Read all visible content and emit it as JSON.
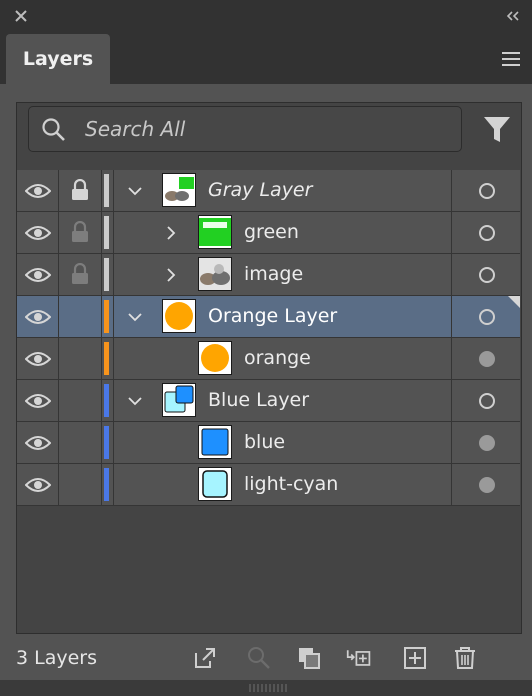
{
  "panel": {
    "tab_label": "Layers",
    "search_placeholder": "Search All",
    "layer_count": "3 Layers"
  },
  "rows": [
    {
      "name": "Gray Layer",
      "italic": true,
      "level": 0,
      "expanded": true,
      "locked": true,
      "lock_dim": false,
      "color": "#cccccc",
      "thumb": "gray",
      "target": "hollow",
      "selected": false
    },
    {
      "name": "green",
      "italic": false,
      "level": 1,
      "expanded": false,
      "has_children": true,
      "locked": true,
      "lock_dim": true,
      "color": "#cccccc",
      "thumb": "green",
      "target": "hollow",
      "selected": false
    },
    {
      "name": "image",
      "italic": false,
      "level": 1,
      "expanded": false,
      "has_children": true,
      "locked": true,
      "lock_dim": true,
      "color": "#cccccc",
      "thumb": "image",
      "target": "hollow",
      "selected": false
    },
    {
      "name": "Orange Layer",
      "italic": false,
      "level": 0,
      "expanded": true,
      "locked": false,
      "color": "#f7941d",
      "thumb": "orange",
      "target": "hollow",
      "selected": true
    },
    {
      "name": "orange",
      "italic": false,
      "level": 1,
      "has_children": false,
      "locked": false,
      "color": "#f7941d",
      "thumb": "orange",
      "target": "filled",
      "selected": false
    },
    {
      "name": "Blue Layer",
      "italic": false,
      "level": 0,
      "expanded": true,
      "locked": false,
      "color": "#4a78e8",
      "thumb": "bluelayer",
      "target": "hollow",
      "selected": false
    },
    {
      "name": "blue",
      "italic": false,
      "level": 1,
      "has_children": false,
      "locked": false,
      "color": "#4a78e8",
      "thumb": "blue",
      "target": "filled",
      "selected": false
    },
    {
      "name": "light-cyan",
      "italic": false,
      "level": 1,
      "has_children": false,
      "locked": false,
      "color": "#4a78e8",
      "thumb": "cyan",
      "target": "filled",
      "selected": false
    }
  ],
  "icons": {
    "close": "close-icon",
    "collapse": "double-chevron-left-icon",
    "menu": "hamburger-menu-icon",
    "search": "search-icon",
    "filter": "filter-icon",
    "bottom": [
      "export-icon",
      "locate-object-icon",
      "make-clipping-mask-icon",
      "collect-in-new-layer-icon",
      "create-new-layer-icon",
      "delete-icon"
    ]
  }
}
